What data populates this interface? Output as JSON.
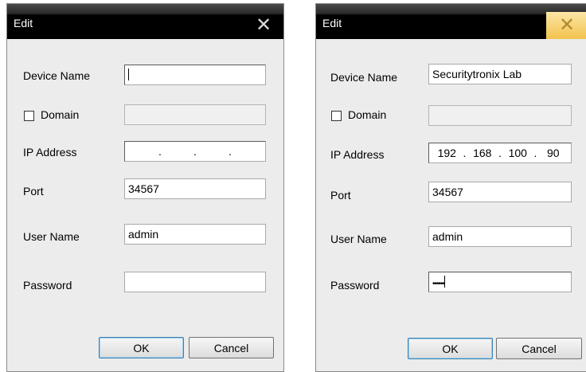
{
  "left_dialog": {
    "title": "Edit",
    "close_glyph": "✕",
    "labels": {
      "device_name": "Device Name",
      "domain": "Domain",
      "ip_address": "IP Address",
      "port": "Port",
      "user_name": "User Name",
      "password": "Password"
    },
    "fields": {
      "device_name": "",
      "domain": "",
      "ip": [
        "",
        "",
        "",
        ""
      ],
      "port": "34567",
      "user_name": "admin",
      "password": ""
    },
    "domain_checked": false,
    "buttons": {
      "ok": "OK",
      "cancel": "Cancel"
    }
  },
  "right_dialog": {
    "title": "Edit",
    "close_glyph": "✕",
    "labels": {
      "device_name": "Device Name",
      "domain": "Domain",
      "ip_address": "IP Address",
      "port": "Port",
      "user_name": "User Name",
      "password": "Password"
    },
    "fields": {
      "device_name": "Securitytronix Lab",
      "domain": "",
      "ip": [
        "192",
        "168",
        "100",
        "90"
      ],
      "port": "34567",
      "user_name": "admin",
      "password_mask": "••••••"
    },
    "domain_checked": false,
    "buttons": {
      "ok": "OK",
      "cancel": "Cancel"
    }
  }
}
